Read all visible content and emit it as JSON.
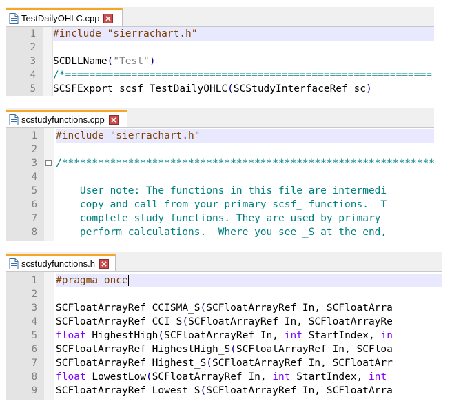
{
  "panes": [
    {
      "tab": {
        "title": "TestDailyOHLC.cpp"
      },
      "lines": [
        {
          "num": "1",
          "tokens": [
            {
              "t": "#include \"sierrachart.h\"",
              "c": "pp"
            }
          ]
        },
        {
          "num": "2",
          "tokens": []
        },
        {
          "num": "3",
          "tokens": [
            {
              "t": "SCDLLName",
              "c": ""
            },
            {
              "t": "(",
              "c": "op"
            },
            {
              "t": "\"Test\"",
              "c": "str"
            },
            {
              "t": ")",
              "c": "op"
            }
          ]
        },
        {
          "num": "4",
          "tokens": [
            {
              "t": "/*=============================================================",
              "c": "cmt"
            }
          ]
        },
        {
          "num": "5",
          "tokens": [
            {
              "t": "SCSFExport scsf_TestDailyOHLC",
              "c": ""
            },
            {
              "t": "(",
              "c": "op"
            },
            {
              "t": "SCStudyInterfaceRef sc",
              "c": ""
            },
            {
              "t": ")",
              "c": "op"
            }
          ]
        }
      ]
    },
    {
      "tab": {
        "title": "scstudyfunctions.cpp"
      },
      "lines": [
        {
          "num": "1",
          "tokens": [
            {
              "t": "#include \"sierrachart.h\"",
              "c": "pp"
            }
          ]
        },
        {
          "num": "2",
          "tokens": []
        },
        {
          "num": "3",
          "tokens": [
            {
              "t": "/************************************************************************",
              "c": "cmt"
            }
          ]
        },
        {
          "num": "4",
          "tokens": []
        },
        {
          "num": "5",
          "tokens": [
            {
              "t": "    User note: The functions in this file are intermedi",
              "c": "cmt"
            }
          ]
        },
        {
          "num": "6",
          "tokens": [
            {
              "t": "    copy and call from your primary scsf_ functions.  T",
              "c": "cmt"
            }
          ]
        },
        {
          "num": "7",
          "tokens": [
            {
              "t": "    complete study functions. They are used by primary",
              "c": "cmt"
            }
          ]
        },
        {
          "num": "8",
          "tokens": [
            {
              "t": "    perform calculations.  Where you see _S at the end,",
              "c": "cmt"
            }
          ]
        }
      ]
    },
    {
      "tab": {
        "title": "scstudyfunctions.h"
      },
      "lines": [
        {
          "num": "1",
          "tokens": [
            {
              "t": "#pragma once",
              "c": "pp"
            }
          ]
        },
        {
          "num": "2",
          "tokens": []
        },
        {
          "num": "3",
          "tokens": [
            {
              "t": "SCFloatArrayRef CCISMA_S",
              "c": ""
            },
            {
              "t": "(",
              "c": "op"
            },
            {
              "t": "SCFloatArrayRef In, SCFloatArra",
              "c": ""
            }
          ]
        },
        {
          "num": "4",
          "tokens": [
            {
              "t": "SCFloatArrayRef CCI_S",
              "c": ""
            },
            {
              "t": "(",
              "c": "op"
            },
            {
              "t": "SCFloatArrayRef In, SCFloatArrayRe",
              "c": ""
            }
          ]
        },
        {
          "num": "5",
          "tokens": [
            {
              "t": "float",
              "c": "kw"
            },
            {
              "t": " HighestHigh",
              "c": ""
            },
            {
              "t": "(",
              "c": "op"
            },
            {
              "t": "SCFloatArrayRef In, ",
              "c": ""
            },
            {
              "t": "int",
              "c": "kw"
            },
            {
              "t": " StartIndex, ",
              "c": ""
            },
            {
              "t": "in",
              "c": "kw"
            }
          ]
        },
        {
          "num": "6",
          "tokens": [
            {
              "t": "SCFloatArrayRef HighestHigh_S",
              "c": ""
            },
            {
              "t": "(",
              "c": "op"
            },
            {
              "t": "SCFloatArrayRef In, SCFloa",
              "c": ""
            }
          ]
        },
        {
          "num": "7",
          "tokens": [
            {
              "t": "SCFloatArrayRef Highest_S",
              "c": ""
            },
            {
              "t": "(",
              "c": "op"
            },
            {
              "t": "SCFloatArrayRef In, SCFloatArr",
              "c": ""
            }
          ]
        },
        {
          "num": "8",
          "tokens": [
            {
              "t": "float",
              "c": "kw"
            },
            {
              "t": " LowestLow",
              "c": ""
            },
            {
              "t": "(",
              "c": "op"
            },
            {
              "t": "SCFloatArrayRef In, ",
              "c": ""
            },
            {
              "t": "int",
              "c": "kw"
            },
            {
              "t": " StartIndex, ",
              "c": ""
            },
            {
              "t": "int",
              "c": "kw"
            }
          ]
        },
        {
          "num": "9",
          "tokens": [
            {
              "t": "SCFloatArrayRef Lowest_S",
              "c": ""
            },
            {
              "t": "(",
              "c": "op"
            },
            {
              "t": "SCFloatArrayRef In, SCFloatArra",
              "c": ""
            }
          ]
        }
      ]
    }
  ],
  "colors": {
    "tab_accent": "#f6a623",
    "current_line": "#e8e8ff",
    "preprocessor": "#804000",
    "string": "#808080",
    "comment": "#008080",
    "keyword": "#8000ff",
    "operator": "#000080",
    "line_number": "#808080"
  },
  "icons": {
    "file": "file-icon",
    "close": "close-icon",
    "fold": "fold-minus-icon"
  }
}
